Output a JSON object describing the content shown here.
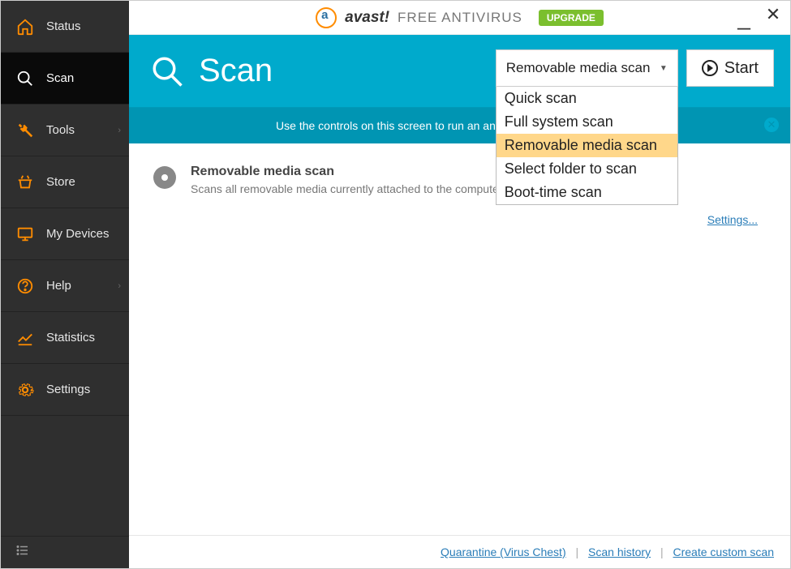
{
  "titlebar": {
    "brand": "avast!",
    "subtitle": "FREE ANTIVIRUS",
    "upgrade": "UPGRADE"
  },
  "sidebar": {
    "items": [
      {
        "label": "Status"
      },
      {
        "label": "Scan"
      },
      {
        "label": "Tools"
      },
      {
        "label": "Store"
      },
      {
        "label": "My Devices"
      },
      {
        "label": "Help"
      },
      {
        "label": "Statistics"
      },
      {
        "label": "Settings"
      }
    ]
  },
  "hero": {
    "title": "Scan"
  },
  "infobar": {
    "text": "Use the controls on this screen to run an antivirus scan of your computer."
  },
  "scan": {
    "section_title": "Removable media scan",
    "section_desc": "Scans all removable media currently attached to the computer.",
    "settings_link": "Settings..."
  },
  "dropdown": {
    "selected": "Removable media scan",
    "options": [
      "Quick scan",
      "Full system scan",
      "Removable media scan",
      "Select folder to scan",
      "Boot-time scan"
    ],
    "highlighted_index": 2
  },
  "start_button": "Start",
  "footer": {
    "quarantine": "Quarantine (Virus Chest)",
    "history": "Scan history",
    "create_custom": "Create custom scan"
  },
  "colors": {
    "accent_orange": "#ff8c00",
    "hero_teal": "#00aacc",
    "info_teal": "#0095b3",
    "link_blue": "#2a7db8",
    "upgrade_green": "#7bbf2e",
    "highlight": "#ffd78a"
  }
}
